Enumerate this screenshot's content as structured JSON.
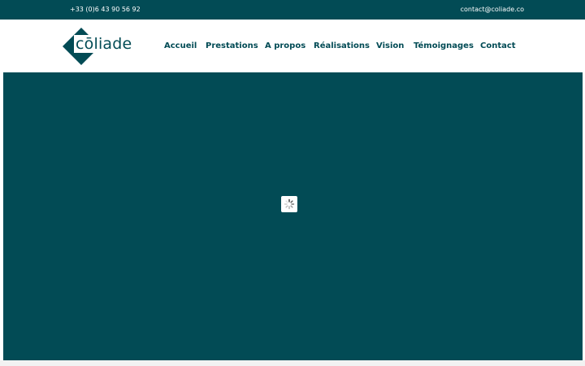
{
  "topbar": {
    "phone": "+33 (0)6 43 90 56 92",
    "email": "contact@coliade.co"
  },
  "brand": {
    "logo_text": "cōliade",
    "logo_color": "#024b55",
    "accent_color": "#e8b62a"
  },
  "nav": {
    "items": [
      {
        "label": "Accueil"
      },
      {
        "label": "Prestations"
      },
      {
        "label": "A propos"
      },
      {
        "label": "Réalisations"
      },
      {
        "label": "Vision"
      },
      {
        "label": "Témoignages"
      },
      {
        "label": "Contact"
      }
    ]
  },
  "hero": {
    "background_color": "#024b55",
    "loader_icon": "spinner-icon"
  },
  "colors": {
    "primary": "#024b55",
    "background": "#ffffff"
  }
}
